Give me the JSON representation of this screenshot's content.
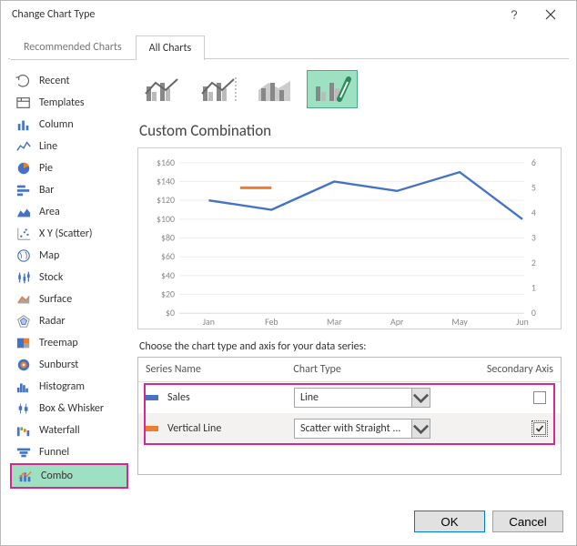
{
  "title": "Change Chart Type",
  "tabs": {
    "recommended": "Recommended Charts",
    "all": "All Charts"
  },
  "sidebar": {
    "items": [
      {
        "label": "Recent",
        "icon": "recent-icon"
      },
      {
        "label": "Templates",
        "icon": "templates-icon"
      },
      {
        "label": "Column",
        "icon": "column-icon"
      },
      {
        "label": "Line",
        "icon": "line-icon"
      },
      {
        "label": "Pie",
        "icon": "pie-icon"
      },
      {
        "label": "Bar",
        "icon": "bar-icon"
      },
      {
        "label": "Area",
        "icon": "area-icon"
      },
      {
        "label": "X Y (Scatter)",
        "icon": "scatter-icon"
      },
      {
        "label": "Map",
        "icon": "map-icon"
      },
      {
        "label": "Stock",
        "icon": "stock-icon"
      },
      {
        "label": "Surface",
        "icon": "surface-icon"
      },
      {
        "label": "Radar",
        "icon": "radar-icon"
      },
      {
        "label": "Treemap",
        "icon": "treemap-icon"
      },
      {
        "label": "Sunburst",
        "icon": "sunburst-icon"
      },
      {
        "label": "Histogram",
        "icon": "histogram-icon"
      },
      {
        "label": "Box & Whisker",
        "icon": "boxwhisker-icon"
      },
      {
        "label": "Waterfall",
        "icon": "waterfall-icon"
      },
      {
        "label": "Funnel",
        "icon": "funnel-icon"
      },
      {
        "label": "Combo",
        "icon": "combo-icon"
      }
    ],
    "selected": 18
  },
  "subtypes": {
    "selected": 3,
    "title": "Custom Combination"
  },
  "chart_preview": {
    "series_colors": {
      "sales": "#4472c4",
      "vline": "#ed7d31"
    },
    "chart_data": {
      "type": "line",
      "categories": [
        "Jan",
        "Feb",
        "Mar",
        "Apr",
        "May",
        "Jun"
      ],
      "ylabel": "",
      "xlabel": "",
      "ylim_left": [
        0,
        160
      ],
      "yticks_left": [
        "$0",
        "$20",
        "$40",
        "$60",
        "$80",
        "$100",
        "$120",
        "$140",
        "$160"
      ],
      "ylim_right": [
        0,
        6
      ],
      "yticks_right": [
        "0",
        "1",
        "2",
        "3",
        "4",
        "5",
        "6"
      ],
      "series": [
        {
          "name": "Sales",
          "axis": "left",
          "values": [
            120,
            110,
            140,
            130,
            150,
            100
          ]
        },
        {
          "name": "Vertical Line",
          "axis": "right",
          "segment": {
            "x": [
              1.5,
              2.0
            ],
            "y": [
              5,
              5
            ]
          }
        }
      ]
    }
  },
  "series_table": {
    "caption": "Choose the chart type and axis for your data series:",
    "headers": {
      "name": "Series Name",
      "type": "Chart Type",
      "axis": "Secondary Axis"
    },
    "rows": [
      {
        "color": "#4472c4",
        "name": "Sales",
        "type": "Line",
        "secondary": false
      },
      {
        "color": "#ed7d31",
        "name": "Vertical Line",
        "type": "Scatter with Straight ...",
        "secondary": true
      }
    ]
  },
  "footer": {
    "ok": "OK",
    "cancel": "Cancel"
  }
}
